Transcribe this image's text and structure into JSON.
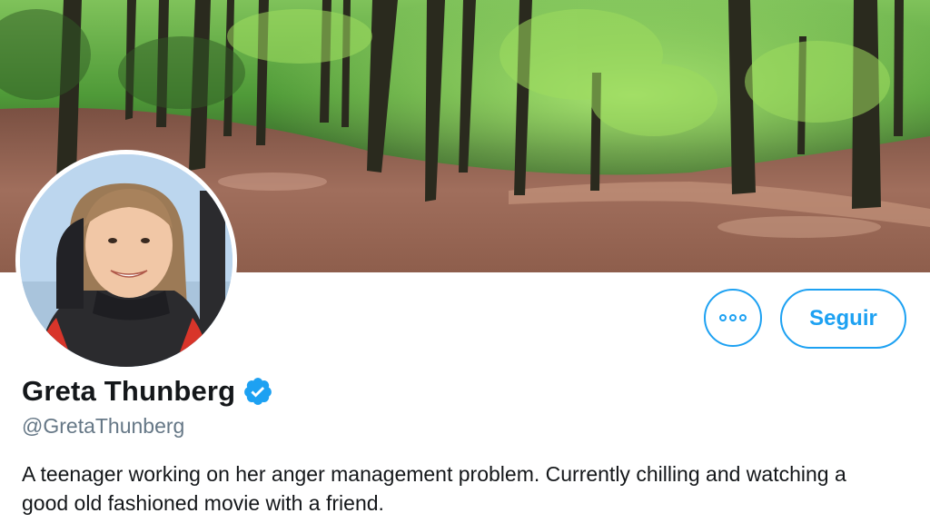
{
  "banner": {
    "image": "forest-photo"
  },
  "avatar": {
    "image": "profile-photo"
  },
  "actions": {
    "more_icon": "more-dots-icon",
    "follow_label": "Seguir"
  },
  "profile": {
    "display_name": "Greta Thunberg",
    "verified_icon": "verified-badge-icon",
    "handle": "@GretaThunberg",
    "bio": "A teenager working on her anger management problem. Currently chilling and watching a good old fashioned movie with a friend."
  },
  "colors": {
    "accent": "#1da1f2",
    "text_primary": "#14171a",
    "text_secondary": "#657786"
  }
}
